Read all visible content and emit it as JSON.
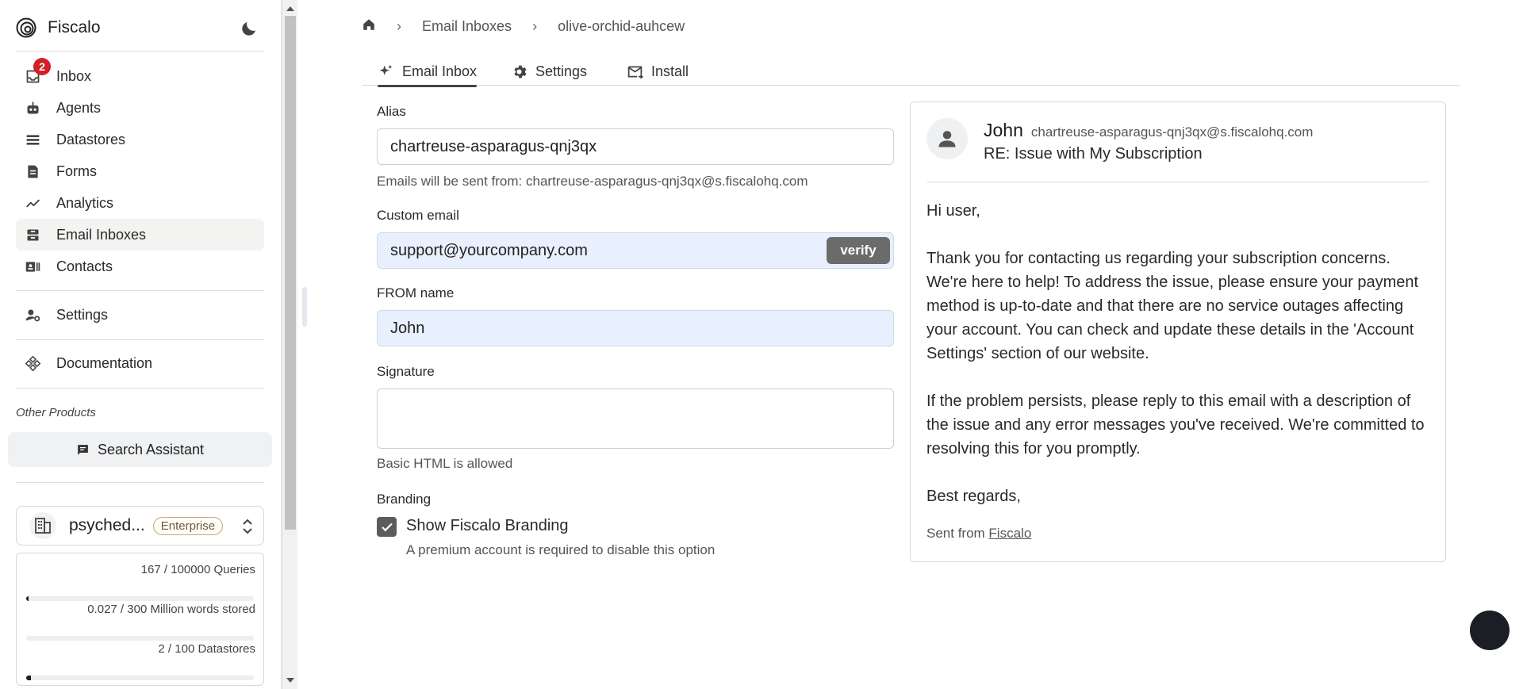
{
  "app": {
    "name": "Fiscalo"
  },
  "sidebar": {
    "items": [
      {
        "label": "Inbox",
        "badge": "2"
      },
      {
        "label": "Agents"
      },
      {
        "label": "Datastores"
      },
      {
        "label": "Forms"
      },
      {
        "label": "Analytics"
      },
      {
        "label": "Email Inboxes"
      },
      {
        "label": "Contacts"
      },
      {
        "label": "Settings"
      },
      {
        "label": "Documentation"
      }
    ],
    "other_products_label": "Other Products",
    "search_assistant_label": "Search Assistant",
    "org": {
      "name": "psyched...",
      "plan": "Enterprise"
    },
    "usage": [
      {
        "text": "167 / 100000 Queries",
        "fraction": 0.00167
      },
      {
        "text": "0.027 / 300 Million words stored",
        "fraction": 9e-05
      },
      {
        "text": "2 / 100 Datastores",
        "fraction": 0.02
      }
    ]
  },
  "breadcrumb": {
    "section": "Email Inboxes",
    "current": "olive-orchid-auhcew"
  },
  "tabs": [
    {
      "label": "Email Inbox",
      "icon": "sparkles-icon"
    },
    {
      "label": "Settings",
      "icon": "gear-icon"
    },
    {
      "label": "Install",
      "icon": "mail-icon"
    }
  ],
  "form": {
    "alias": {
      "label": "Alias",
      "value": "chartreuse-asparagus-qnj3qx",
      "helper": "Emails will be sent from: chartreuse-asparagus-qnj3qx@s.fiscalohq.com"
    },
    "custom_email": {
      "label": "Custom email",
      "value": "support@yourcompany.com",
      "verify_label": "verify"
    },
    "from_name": {
      "label": "FROM name",
      "value": "John"
    },
    "signature": {
      "label": "Signature",
      "value": "",
      "helper": "Basic HTML is allowed"
    },
    "branding": {
      "label": "Branding",
      "checkbox_label": "Show Fiscalo Branding",
      "checked": true,
      "helper": "A premium account is required to disable this option"
    }
  },
  "preview": {
    "from_name": "John",
    "from_address": "chartreuse-asparagus-qnj3qx@s.fiscalohq.com",
    "subject": "RE: Issue with My Subscription",
    "body": [
      "Hi user,",
      "Thank you for contacting us regarding your subscription concerns. We're here to help! To address the issue, please ensure your payment method is up-to-date and that there are no service outages affecting your account. You can check and update these details in the 'Account Settings' section of our website.",
      "If the problem persists, please reply to this email with a description of the issue and any error messages you've received. We're committed to resolving this for you promptly.",
      "Best regards,"
    ],
    "sent_from_prefix": "Sent from ",
    "sent_from_link": "Fiscalo"
  }
}
